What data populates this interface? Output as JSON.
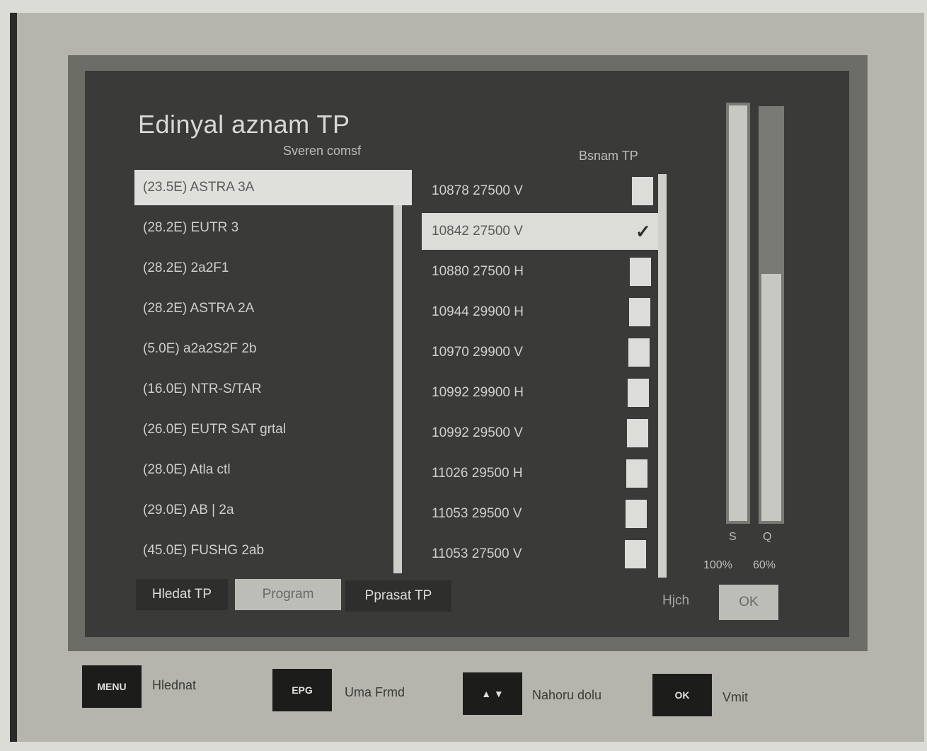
{
  "screen": {
    "title": "Edinyal aznam TP",
    "left_column_header": "Sveren comsf",
    "right_column_header": "Bsnam TP"
  },
  "satellites": [
    {
      "label": "(23.5E) ASTRA 3A",
      "selected": true
    },
    {
      "label": "(28.2E) EUTR 3",
      "selected": false
    },
    {
      "label": "(28.2E) 2a2F1",
      "selected": false
    },
    {
      "label": "(28.2E) ASTRA 2A",
      "selected": false
    },
    {
      "label": "(5.0E) a2a2S2F 2b",
      "selected": false
    },
    {
      "label": "(16.0E) NTR-S/TAR",
      "selected": false
    },
    {
      "label": "(26.0E) EUTR SAT grtal",
      "selected": false
    },
    {
      "label": "(28.0E) Atla ctl",
      "selected": false
    },
    {
      "label": "(29.0E) AB | 2a",
      "selected": false
    },
    {
      "label": "(45.0E) FUSHG 2ab",
      "selected": false
    }
  ],
  "transponders": [
    {
      "label": "10878 27500 V",
      "checked": false,
      "selected": false
    },
    {
      "label": "10842 27500 V",
      "checked": true,
      "selected": true
    },
    {
      "label": "10880 27500 H",
      "checked": false,
      "selected": false
    },
    {
      "label": "10944 29900 H",
      "checked": false,
      "selected": false
    },
    {
      "label": "10970 29900 V",
      "checked": false,
      "selected": false
    },
    {
      "label": "10992 29900 H",
      "checked": false,
      "selected": false
    },
    {
      "label": "10992 29500 V",
      "checked": false,
      "selected": false
    },
    {
      "label": "11026 29500 H",
      "checked": false,
      "selected": false
    },
    {
      "label": "11053 29500 V",
      "checked": false,
      "selected": false
    },
    {
      "label": "11053 27500 V",
      "checked": false,
      "selected": false
    }
  ],
  "meters": {
    "signal_letter": "S",
    "signal_percent": "100%",
    "signal_level": 1.0,
    "quality_letter": "Q",
    "quality_percent": "60%",
    "quality_level": 0.6
  },
  "buttons": {
    "add_tp": "Hledat TP",
    "program": "Program",
    "edit_tp": "Pprasat TP",
    "scan_label": "Hjch",
    "ok": "OK"
  },
  "legend": [
    {
      "key": "MENU",
      "text": "Hlednat"
    },
    {
      "key": "EPG",
      "text": "Uma Frmd"
    },
    {
      "key": "▲ ▼",
      "text": "Nahoru dolu"
    },
    {
      "key": "OK",
      "text": "Vmit"
    }
  ]
}
